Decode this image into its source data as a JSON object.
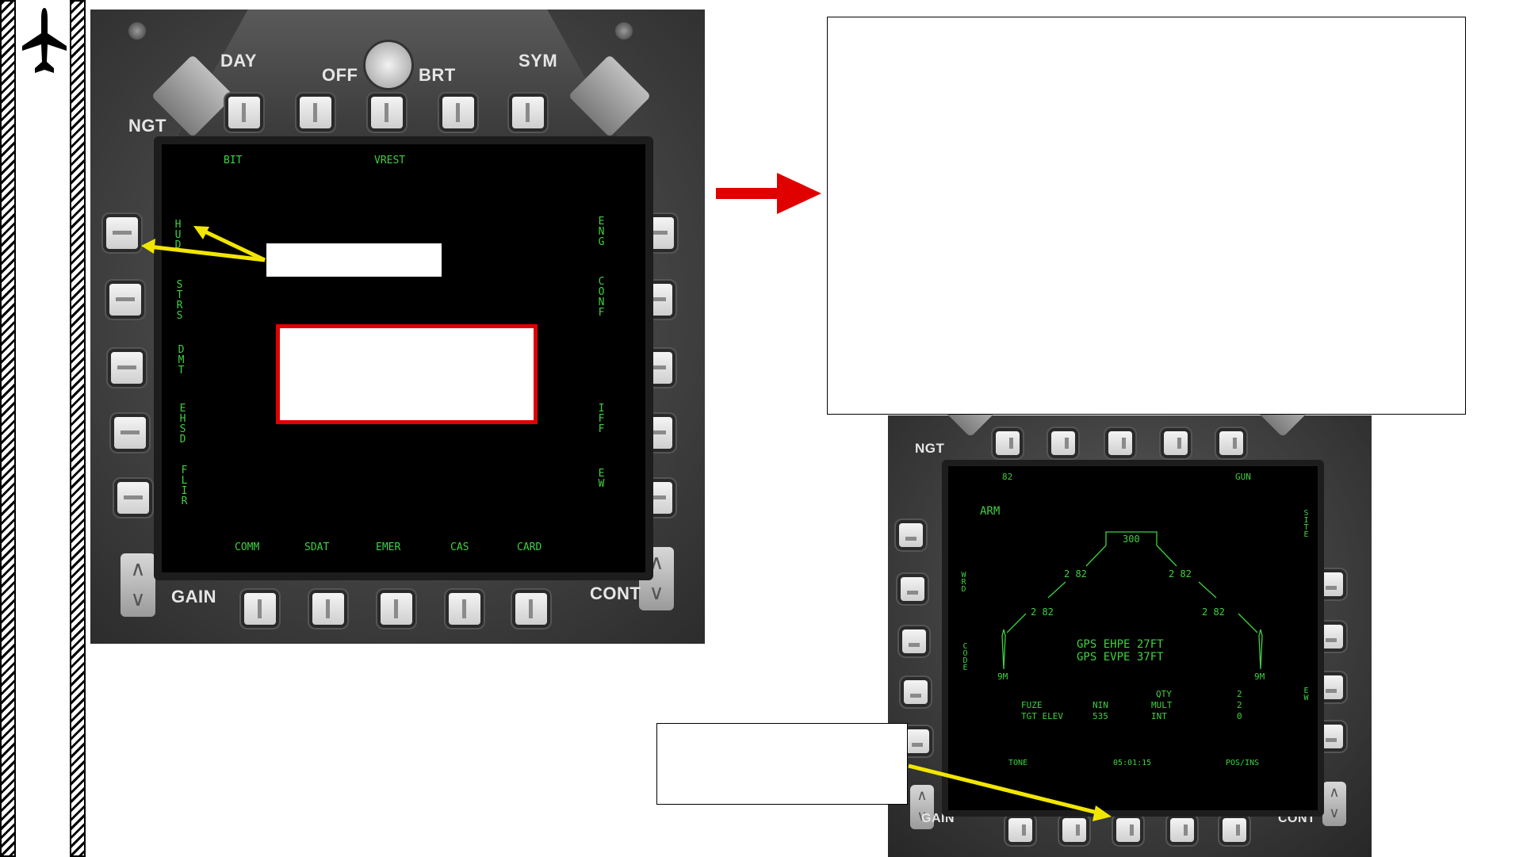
{
  "left_mfd": {
    "bezel_labels": {
      "day": "DAY",
      "off": "OFF",
      "brt": "BRT",
      "sym": "SYM",
      "ngt": "NGT",
      "gain": "GAIN",
      "cont": "CONT"
    },
    "top_options": [
      "BIT",
      "VREST"
    ],
    "left_options": [
      "HUD",
      "STRS",
      "DMT",
      "EHSD",
      "FLIR"
    ],
    "right_options": [
      "ENG",
      "CONF",
      "IFF",
      "EW"
    ],
    "bottom_options": [
      "COMM",
      "SDAT",
      "EMER",
      "CAS",
      "CARD"
    ]
  },
  "right_mfd": {
    "bezel_labels": {
      "ngt": "NGT",
      "gain": "GAIN",
      "cont": "CONT"
    },
    "top_left": "82",
    "top_right": "GUN",
    "arm": "ARM",
    "left_vertical_1": "WRD",
    "left_vertical_2": "CODE",
    "right_vertical_1": "SITE",
    "right_vertical_2": "EW",
    "release_box": "300",
    "stations": {
      "upper_left": "2 82",
      "upper_right": "2 82",
      "lower_left": "2 82",
      "lower_right": "2 82",
      "missile_left": "9M",
      "missile_right": "9M"
    },
    "gps_ehpe": "GPS EHPE 27FT",
    "gps_evpe": "GPS EVPE 37FT",
    "fuze_label": "FUZE",
    "fuze_value": "NIN",
    "tgt_elev_label": "TGT ELEV",
    "tgt_elev_value": "535",
    "qty_label": "QTY",
    "qty_value": "2",
    "mult_label": "MULT",
    "mult_value": "2",
    "int_label": "INT",
    "int_value": "0",
    "bottom_options": [
      "TONE",
      "05:01:15",
      "POS/INS"
    ]
  },
  "colors": {
    "mfd_text": "#3fd13f",
    "arrow_red": "#e00000",
    "arrow_yellow": "#f2e600",
    "highlight_box": "#e00000"
  },
  "icons": [
    "aircraft-icon"
  ]
}
